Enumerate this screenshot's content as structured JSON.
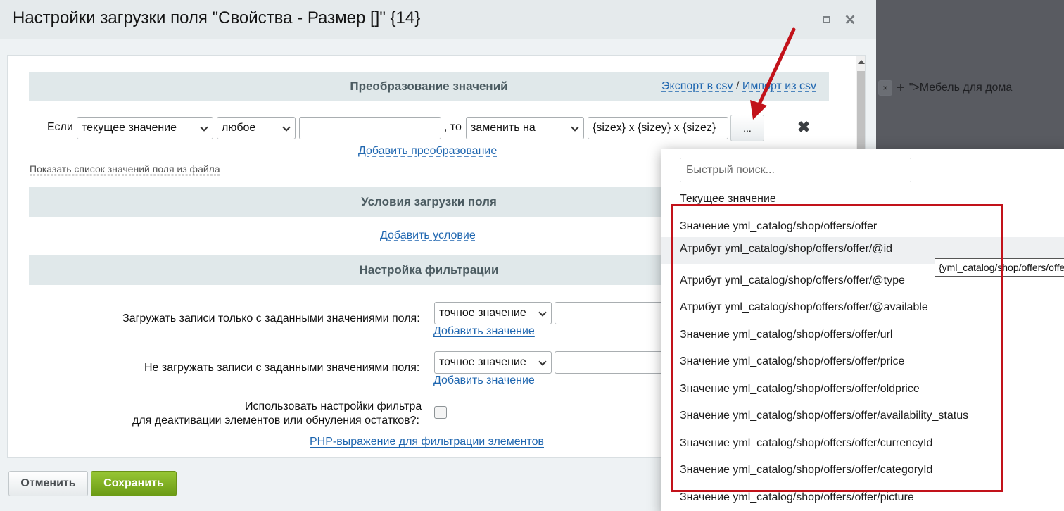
{
  "background": {
    "breadcrumb_x": "×",
    "breadcrumb_plus": "+",
    "breadcrumb_text": "\">Мебель для дома"
  },
  "dialog": {
    "title": "Настройки загрузки поля \"Свойства - Размер []\" {14}",
    "maximize_icon": "maximize-icon",
    "close_icon": "close-icon",
    "close_glyph": "✕"
  },
  "transform": {
    "section_title": "Преобразование значений",
    "export_csv": "Экспорт в csv",
    "separator": "/",
    "import_csv": "Импорт из csv",
    "if_label": "Если",
    "select_field": "текущее значение",
    "select_condition": "любое",
    "condition_value": "",
    "then_label": ", то",
    "select_action": "заменить на",
    "replace_value": "{sizex} x {sizey} x {sizez}",
    "dots_button": "...",
    "delete_glyph": "✖",
    "add_transform": "Добавить преобразование",
    "show_list_link": "Показать список значений поля из файла"
  },
  "conditions": {
    "section_title": "Условия загрузки поля",
    "add_condition": "Добавить условие"
  },
  "filter": {
    "section_title": "Настройка фильтрации",
    "only_label": "Загружать записи только с заданными значениями поля:",
    "only_select": "точное значение",
    "only_add": "Добавить значение",
    "exclude_label": "Не загружать записи с заданными значениями поля:",
    "exclude_select": "точное значение",
    "exclude_add": "Добавить значение",
    "deactivate_label_line1": "Использовать настройки фильтра",
    "deactivate_label_line2": "для деактивации элементов или обнуления остатков?:",
    "php_link": "PHP-выражение для фильтрации элементов"
  },
  "footer": {
    "cancel": "Отменить",
    "save": "Сохранить"
  },
  "dropdown": {
    "search_placeholder": "Быстрый поиск...",
    "items": [
      "Текущее значение",
      "Значение yml_catalog/shop/offers/offer",
      "Атрибут yml_catalog/shop/offers/offer/@id",
      "Атрибут yml_catalog/shop/offers/offer/@type",
      "Атрибут yml_catalog/shop/offers/offer/@available",
      "Значение yml_catalog/shop/offers/offer/url",
      "Значение yml_catalog/shop/offers/offer/price",
      "Значение yml_catalog/shop/offers/offer/oldprice",
      "Значение yml_catalog/shop/offers/offer/availability_status",
      "Значение yml_catalog/shop/offers/offer/currencyId",
      "Значение yml_catalog/shop/offers/offer/categoryId",
      "Значение yml_catalog/shop/offers/offer/picture"
    ],
    "highlighted_index": 2,
    "tooltip": "{yml_catalog/shop/offers/offer/@id}"
  },
  "annotation": {
    "frame_color": "#c2121a",
    "arrow_color": "#c2121a"
  }
}
